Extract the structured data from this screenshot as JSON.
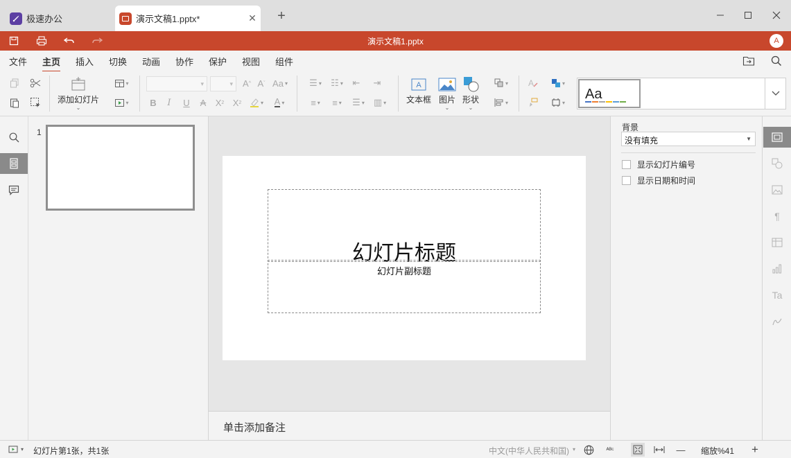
{
  "tabs": {
    "home_label": "极速办公",
    "doc_label": "演示文稿1.pptx*"
  },
  "quickbar": {
    "title": "演示文稿1.pptx",
    "avatar_letter": "A"
  },
  "menu": {
    "file": "文件",
    "home": "主页",
    "insert": "插入",
    "transition": "切换",
    "animation": "动画",
    "collaborate": "协作",
    "protect": "保护",
    "view": "视图",
    "components": "组件"
  },
  "ribbon": {
    "add_slide": "添加幻灯片",
    "textbox": "文本框",
    "picture": "图片",
    "shape": "形状",
    "style_preview": "Aa"
  },
  "thumbnails": [
    {
      "number": "1"
    }
  ],
  "slide": {
    "title_placeholder": "幻灯片标题",
    "subtitle_placeholder": "幻灯片副标题"
  },
  "notes": {
    "placeholder": "单击添加备注"
  },
  "right_panel": {
    "background_label": "背景",
    "fill_value": "没有填充",
    "show_slide_number": "显示幻灯片编号",
    "show_datetime": "显示日期和时间"
  },
  "status": {
    "slide_info": "幻灯片第1张，共1张",
    "language": "中文(中华人民共和国)",
    "zoom": "缩放%41"
  },
  "colors": {
    "accent": "#c8472c",
    "home_icon": "#5c3fa3"
  }
}
